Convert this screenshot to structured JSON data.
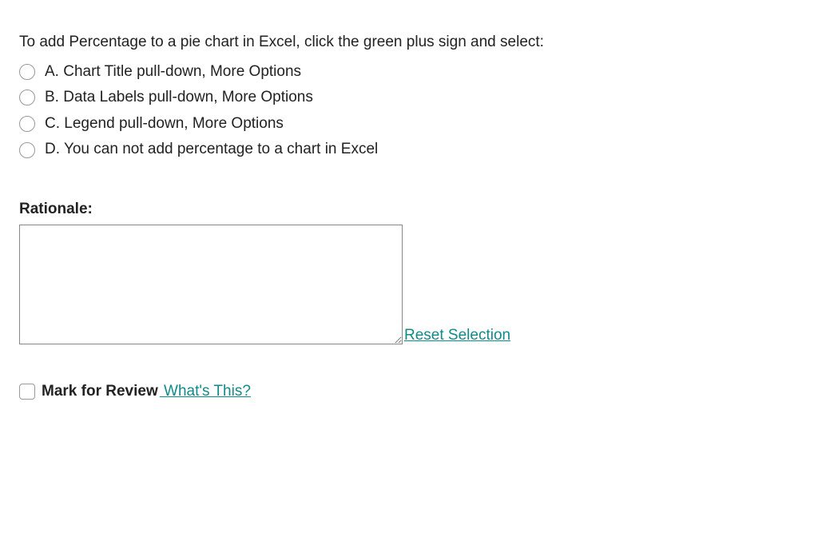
{
  "question": "To add Percentage to a pie chart in Excel, click the green plus sign and select:",
  "options": [
    {
      "letter": "A.",
      "text": "Chart Title pull-down, More Options"
    },
    {
      "letter": "B.",
      "text": "Data Labels pull-down, More Options"
    },
    {
      "letter": "C.",
      "text": "Legend pull-down, More Options"
    },
    {
      "letter": "D.",
      "text": "You can not add percentage to a chart in Excel"
    }
  ],
  "rationale_label": "Rationale:",
  "rationale_value": "",
  "reset_link": "Reset Selection",
  "mark_review_label": "Mark for Review",
  "whats_this_label": " What's This?"
}
